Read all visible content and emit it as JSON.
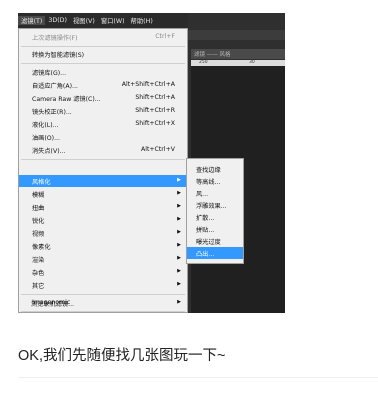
{
  "menubar": [
    "滤镜(T)",
    "3D(D)",
    "视图(V)",
    "窗口(W)",
    "帮助(H)"
  ],
  "ps_right": {
    "tab_text": "滤镜 —— 风格",
    "ruler_marks": [
      "250",
      "30"
    ]
  },
  "filter_menu": {
    "items": [
      {
        "label": "上次滤镜操作(F)",
        "shortcut": "Ctrl+F",
        "disabled": true
      },
      {
        "label": "转换为智能滤镜(S)",
        "shortcut": ""
      },
      {
        "label": "滤镜库(G)...",
        "shortcut": ""
      },
      {
        "label": "自适应广角(A)...",
        "shortcut": "Alt+Shift+Ctrl+A"
      },
      {
        "label": "Camera Raw 滤镜(C)...",
        "shortcut": "Shift+Ctrl+A"
      },
      {
        "label": "镜头校正(R)...",
        "shortcut": "Shift+Ctrl+R"
      },
      {
        "label": "液化(L)...",
        "shortcut": "Shift+Ctrl+X"
      },
      {
        "label": "油画(O)...",
        "shortcut": ""
      },
      {
        "label": "消失点(V)...",
        "shortcut": "Alt+Ctrl+V"
      },
      {
        "label": "风格化",
        "submenu": true,
        "highlighted": true
      },
      {
        "label": "模糊",
        "submenu": true
      },
      {
        "label": "扭曲",
        "submenu": true
      },
      {
        "label": "锐化",
        "submenu": true
      },
      {
        "label": "视频",
        "submenu": true
      },
      {
        "label": "像素化",
        "submenu": true
      },
      {
        "label": "渲染",
        "submenu": true
      },
      {
        "label": "杂色",
        "submenu": true
      },
      {
        "label": "其它",
        "submenu": true
      },
      {
        "label": "Imagenomic",
        "submenu": true
      },
      {
        "label": "浏览联机滤镜...",
        "shortcut": ""
      }
    ]
  },
  "stylize_submenu": {
    "items": [
      "查找边缘",
      "等高线...",
      "风...",
      "浮雕效果...",
      "扩散...",
      "拼贴...",
      "曝光过度",
      "凸出..."
    ],
    "highlighted": "凸出..."
  },
  "article": {
    "text": "OK,我们先随便找几张图玩一下~"
  }
}
